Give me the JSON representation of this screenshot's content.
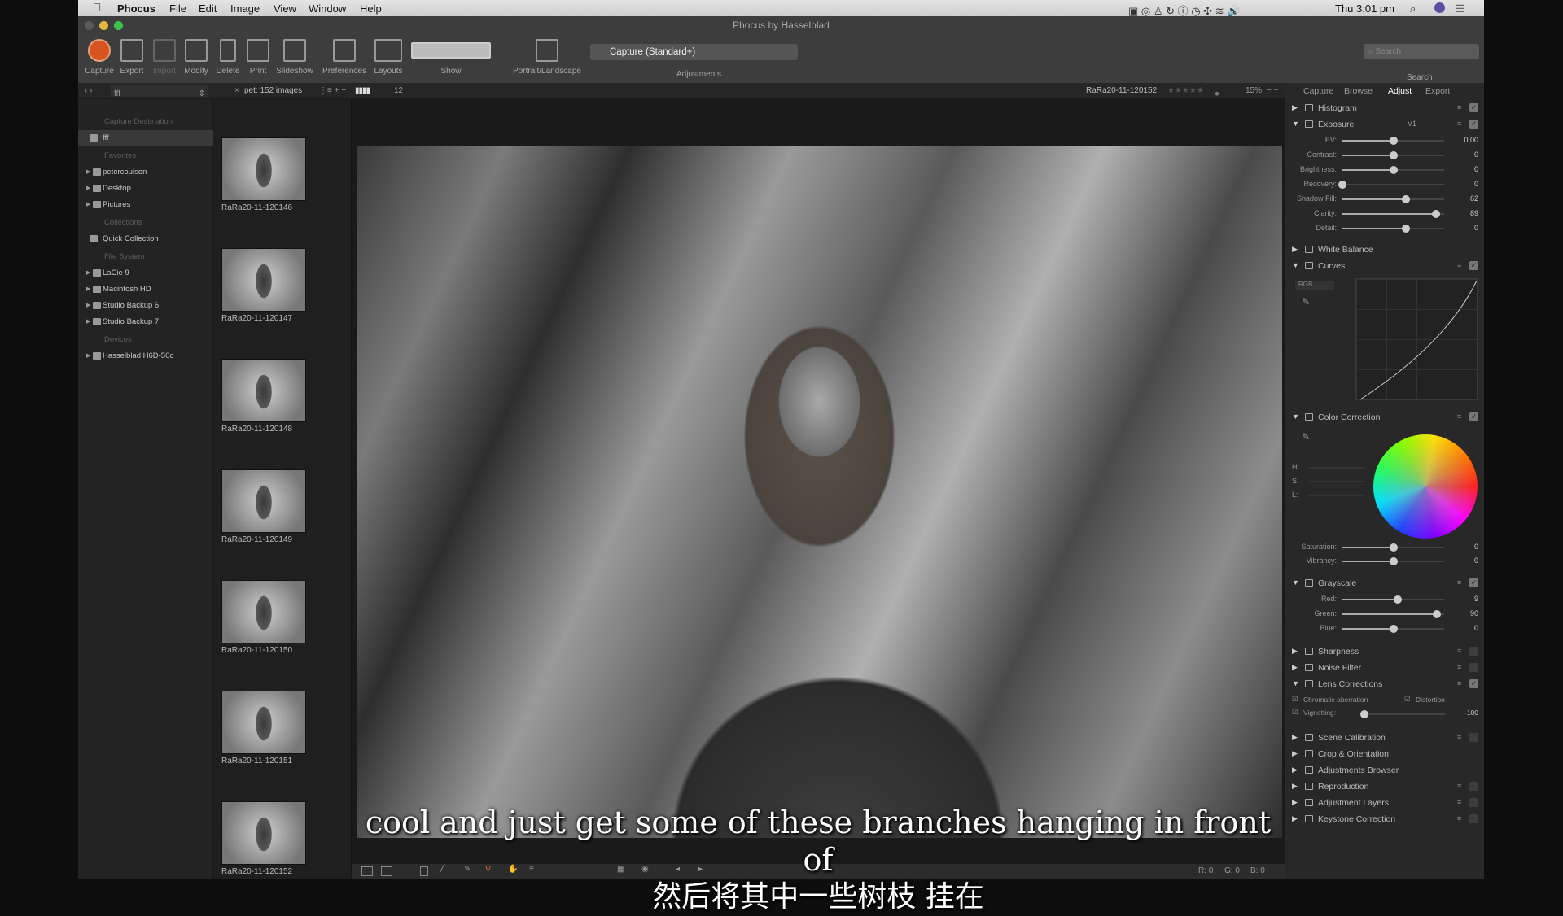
{
  "menubar": {
    "app": "Phocus",
    "items": [
      "File",
      "Edit",
      "Image",
      "View",
      "Window",
      "Help"
    ],
    "clock": "Thu 3:01 pm"
  },
  "window": {
    "title": "Phocus by Hasselblad"
  },
  "toolbar": {
    "buttons": [
      "Capture",
      "Export",
      "Import",
      "Modify",
      "Delete",
      "Print",
      "Slideshow",
      "Preferences",
      "Layouts",
      "Show",
      "Portrait/Landscape"
    ],
    "preset": "Capture (Standard+)",
    "adjustments_label": "Adjustments",
    "search_placeholder": "Search",
    "search_label": "Search"
  },
  "secbar": {
    "folder": "fff",
    "filter": "pet: 152 images",
    "thumb_size": "12",
    "current_image": "RaRa20-11-120152",
    "zoom": "15%"
  },
  "tabs": [
    "Capture",
    "Browse",
    "Adjust",
    "Export"
  ],
  "active_tab": "Adjust",
  "sidebar": [
    {
      "label": "Capture Destination",
      "type": "header"
    },
    {
      "label": "fff",
      "type": "folder",
      "selected": true
    },
    {
      "label": "Favorites",
      "type": "header"
    },
    {
      "label": "petercoulson",
      "type": "item"
    },
    {
      "label": "Desktop",
      "type": "item"
    },
    {
      "label": "Pictures",
      "type": "item"
    },
    {
      "label": "Collections",
      "type": "header"
    },
    {
      "label": "Quick Collection",
      "type": "collection"
    },
    {
      "label": "File System",
      "type": "header"
    },
    {
      "label": "LaCie 9",
      "type": "item"
    },
    {
      "label": "Macintosh HD",
      "type": "item"
    },
    {
      "label": "Studio Backup 6",
      "type": "item"
    },
    {
      "label": "Studio Backup 7",
      "type": "item"
    },
    {
      "label": "Devices",
      "type": "header"
    },
    {
      "label": "Hasselblad H6D-50c",
      "type": "item"
    }
  ],
  "thumbnails": [
    "RaRa20-11-120146",
    "RaRa20-11-120147",
    "RaRa20-11-120148",
    "RaRa20-11-120149",
    "RaRa20-11-120150",
    "RaRa20-11-120151",
    "RaRa20-11-120152"
  ],
  "subtitles": {
    "en": "cool and just get some of these branches hanging in front of",
    "zh": "然后将其中一些树枝 挂在"
  },
  "readout": {
    "r": "R: 0",
    "g": "G: 0",
    "b": "B: 0"
  },
  "panel": {
    "histogram": "Histogram",
    "exposure": {
      "title": "Exposure",
      "version": "V1",
      "sliders": [
        {
          "label": "EV:",
          "value": "0,00",
          "pos": 0.5
        },
        {
          "label": "Contrast:",
          "value": "0",
          "pos": 0.5
        },
        {
          "label": "Brightness:",
          "value": "0",
          "pos": 0.5
        },
        {
          "label": "Recovery:",
          "value": "0",
          "pos": 0
        },
        {
          "label": "Shadow Fill:",
          "value": "62",
          "pos": 0.62
        },
        {
          "label": "Clarity:",
          "value": "89",
          "pos": 0.92
        },
        {
          "label": "Detail:",
          "value": "0",
          "pos": 0.62
        }
      ]
    },
    "white_balance": "White Balance",
    "curves": {
      "title": "Curves",
      "channel": "RGB"
    },
    "color_correction": {
      "title": "Color Correction",
      "hsl": [
        "H:",
        "S:",
        "L:"
      ],
      "sliders": [
        {
          "label": "Saturation:",
          "value": "0",
          "pos": 0.5
        },
        {
          "label": "Vibrancy:",
          "value": "0",
          "pos": 0.5
        }
      ]
    },
    "grayscale": {
      "title": "Grayscale",
      "sliders": [
        {
          "label": "Red:",
          "value": "9",
          "pos": 0.54
        },
        {
          "label": "Green:",
          "value": "90",
          "pos": 0.93
        },
        {
          "label": "Blue:",
          "value": "0",
          "pos": 0.5
        }
      ]
    },
    "sharpness": "Sharpness",
    "noise": "Noise Filter",
    "lens": {
      "title": "Lens Corrections",
      "chromatic": "Chromatic aberration",
      "distortion": "Distortion",
      "vignetting": "Vignetting:",
      "vignetting_value": "-100",
      "vignetting_pos": 0
    },
    "more": [
      "Scene Calibration",
      "Crop & Orientation",
      "Adjustments Browser",
      "Reproduction",
      "Adjustment Layers",
      "Keystone Correction"
    ]
  }
}
